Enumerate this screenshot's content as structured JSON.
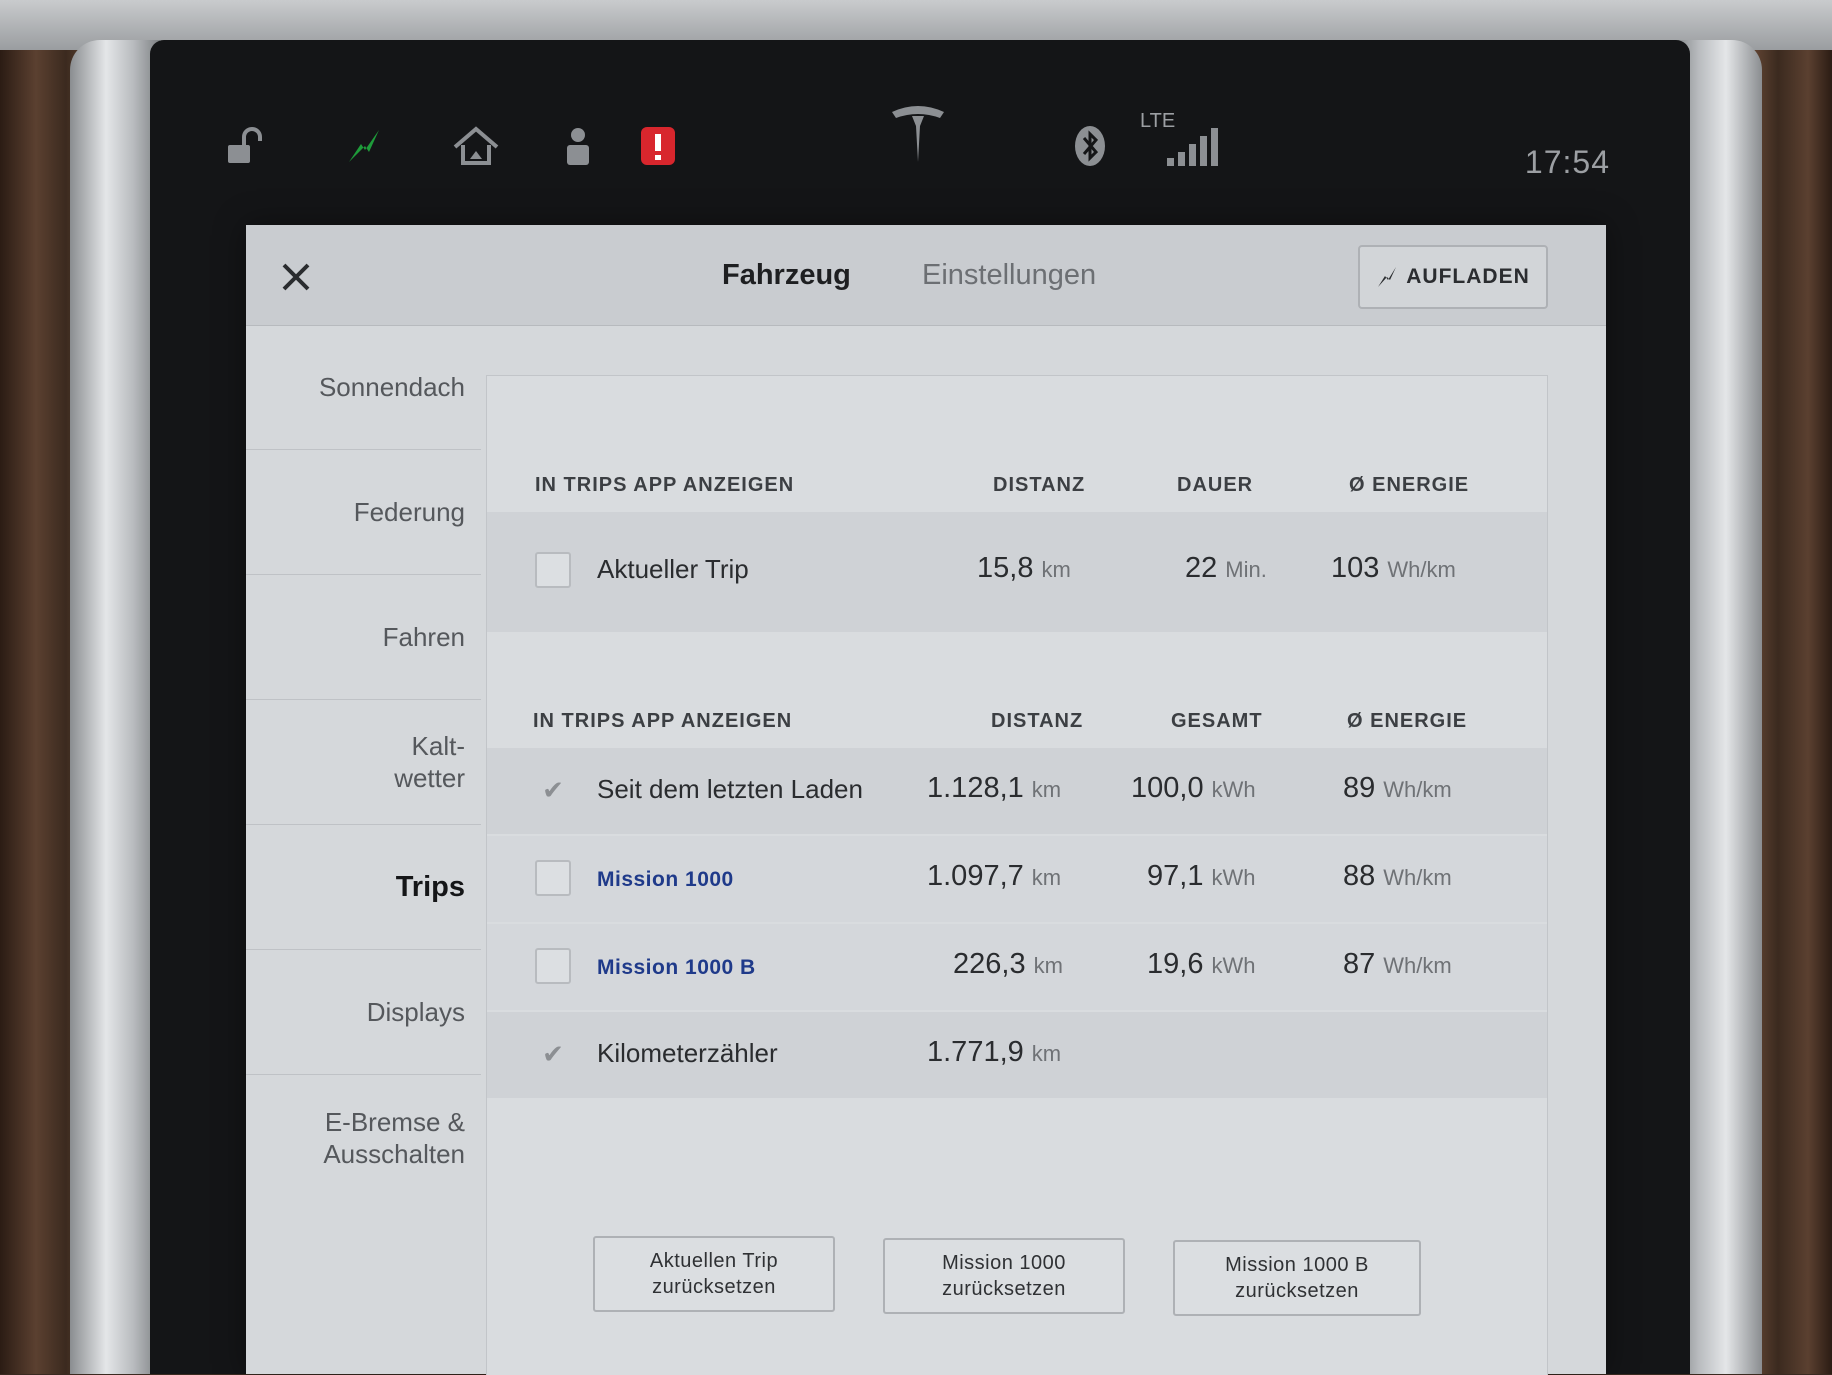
{
  "status_bar": {
    "time": "17:54",
    "network_label": "LTE",
    "icons": [
      "lock-open-icon",
      "charging-bolt-icon",
      "homelink-icon",
      "driver-profile-icon",
      "alert-icon",
      "tesla-logo-icon",
      "bluetooth-icon",
      "signal-icon"
    ],
    "colors": {
      "charging": "#1e9c3a",
      "alert": "#d8262d"
    }
  },
  "dialog": {
    "tabs": [
      {
        "label": "Fahrzeug",
        "active": true
      },
      {
        "label": "Einstellungen",
        "active": false
      }
    ],
    "charge_button": "AUFLADEN"
  },
  "sidebar": {
    "items": [
      {
        "label": "Sonnendach"
      },
      {
        "label": "Federung"
      },
      {
        "label": "Fahren"
      },
      {
        "label": "Kalt-\nwetter"
      },
      {
        "label": "Trips",
        "active": true
      },
      {
        "label": "Displays"
      },
      {
        "label": "E-Bremse &\nAusschalten"
      }
    ]
  },
  "current_trip": {
    "headers": {
      "show": "IN TRIPS APP ANZEIGEN",
      "distance": "DISTANZ",
      "duration": "DAUER",
      "energy": "Ø ENERGIE"
    },
    "row": {
      "label": "Aktueller Trip",
      "checked": false,
      "distance": "15,8",
      "distance_unit": "km",
      "duration": "22",
      "duration_unit": "Min.",
      "energy": "103",
      "energy_unit": "Wh/km"
    }
  },
  "trips": {
    "headers": {
      "show": "IN TRIPS APP ANZEIGEN",
      "distance": "DISTANZ",
      "total": "GESAMT",
      "energy": "Ø ENERGIE"
    },
    "rows": [
      {
        "label": "Seit dem letzten Laden",
        "checked": true,
        "distance": "1.128,1",
        "distance_unit": "km",
        "total": "100,0",
        "total_unit": "kWh",
        "energy": "89",
        "energy_unit": "Wh/km"
      },
      {
        "label": "Mission 1000",
        "checked": false,
        "distance": "1.097,7",
        "distance_unit": "km",
        "total": "97,1",
        "total_unit": "kWh",
        "energy": "88",
        "energy_unit": "Wh/km"
      },
      {
        "label": "Mission 1000 B",
        "checked": false,
        "distance": "226,3",
        "distance_unit": "km",
        "total": "19,6",
        "total_unit": "kWh",
        "energy": "87",
        "energy_unit": "Wh/km"
      },
      {
        "label": "Kilometerzähler",
        "checked": true,
        "distance": "1.771,9",
        "distance_unit": "km"
      }
    ]
  },
  "reset_buttons": [
    {
      "line1": "Aktuellen Trip",
      "line2": "zurücksetzen"
    },
    {
      "line1": "Mission 1000",
      "line2": "zurücksetzen"
    },
    {
      "line1": "Mission 1000 B",
      "line2": "zurücksetzen"
    }
  ]
}
